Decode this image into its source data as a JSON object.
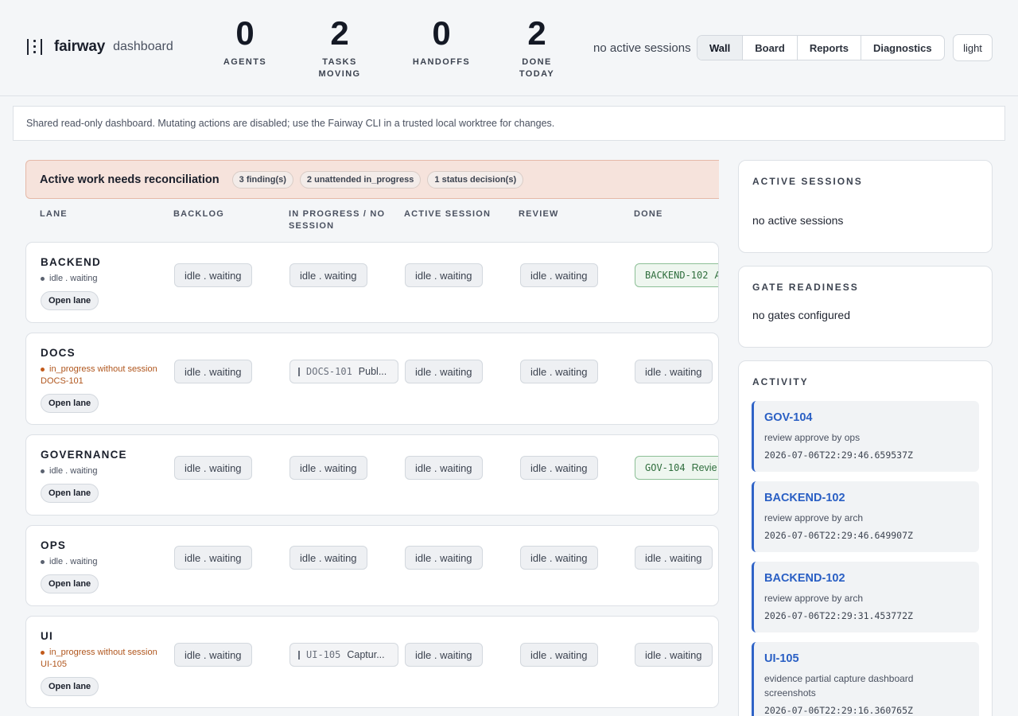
{
  "brand": {
    "name": "fairway",
    "subtitle": "dashboard"
  },
  "stats": [
    {
      "value": "0",
      "label_line1": "AGENTS",
      "label_line2": ""
    },
    {
      "value": "2",
      "label_line1": "TASKS",
      "label_line2": "MOVING"
    },
    {
      "value": "0",
      "label_line1": "HANDOFFS",
      "label_line2": ""
    },
    {
      "value": "2",
      "label_line1": "DONE",
      "label_line2": "TODAY"
    }
  ],
  "header": {
    "session_status": "no active sessions",
    "theme_toggle": "light"
  },
  "tabs": [
    {
      "label": "Wall",
      "active": true
    },
    {
      "label": "Board",
      "active": false
    },
    {
      "label": "Reports",
      "active": false
    },
    {
      "label": "Diagnostics",
      "active": false
    }
  ],
  "notice": "Shared read-only dashboard. Mutating actions are disabled; use the Fairway CLI in a trusted local worktree for changes.",
  "banner": {
    "title": "Active work needs reconciliation",
    "pills": [
      "3 finding(s)",
      "2 unattended in_progress",
      "1 status decision(s)"
    ],
    "bg_color": "#f6e3dc"
  },
  "columns": {
    "lane": "LANE",
    "backlog": "BACKLOG",
    "in_progress_line1": "IN PROGRESS / NO",
    "in_progress_line2": "SESSION",
    "active_session": "ACTIVE SESSION",
    "review": "REVIEW",
    "done": "DONE"
  },
  "idle_label": "idle . waiting",
  "open_lane_label": "Open lane",
  "lanes": [
    {
      "name": "BACKEND",
      "status": "idle . waiting",
      "warning": false,
      "ticket": "",
      "in_progress": null,
      "done": {
        "id": "BACKEND-102",
        "title": "A"
      }
    },
    {
      "name": "DOCS",
      "status": "in_progress without session",
      "warning": true,
      "ticket": "DOCS-101",
      "in_progress": {
        "id": "DOCS-101",
        "title": "Publ..."
      },
      "done": null
    },
    {
      "name": "GOVERNANCE",
      "status": "idle . waiting",
      "warning": false,
      "ticket": "",
      "in_progress": null,
      "done": {
        "id": "GOV-104",
        "title": "Revie"
      }
    },
    {
      "name": "OPS",
      "status": "idle . waiting",
      "warning": false,
      "ticket": "",
      "in_progress": null,
      "done": null
    },
    {
      "name": "UI",
      "status": "in_progress without session",
      "warning": true,
      "ticket": "UI-105",
      "in_progress": {
        "id": "UI-105",
        "title": "Captur..."
      },
      "done": null
    }
  ],
  "active_sessions": {
    "title": "ACTIVE SESSIONS",
    "text": "no active sessions"
  },
  "gate_readiness": {
    "title": "GATE READINESS",
    "text": "no gates configured"
  },
  "activity": {
    "title": "ACTIVITY",
    "accent_color": "#2f63c7",
    "items": [
      {
        "id": "GOV-104",
        "desc": "review approve by ops",
        "time": "2026-07-06T22:29:46.659537Z"
      },
      {
        "id": "BACKEND-102",
        "desc": "review approve by arch",
        "time": "2026-07-06T22:29:46.649907Z"
      },
      {
        "id": "BACKEND-102",
        "desc": "review approve by arch",
        "time": "2026-07-06T22:29:31.453772Z"
      },
      {
        "id": "UI-105",
        "desc": "evidence partial capture dashboard screenshots",
        "time": "2026-07-06T22:29:16.360765Z"
      }
    ]
  }
}
